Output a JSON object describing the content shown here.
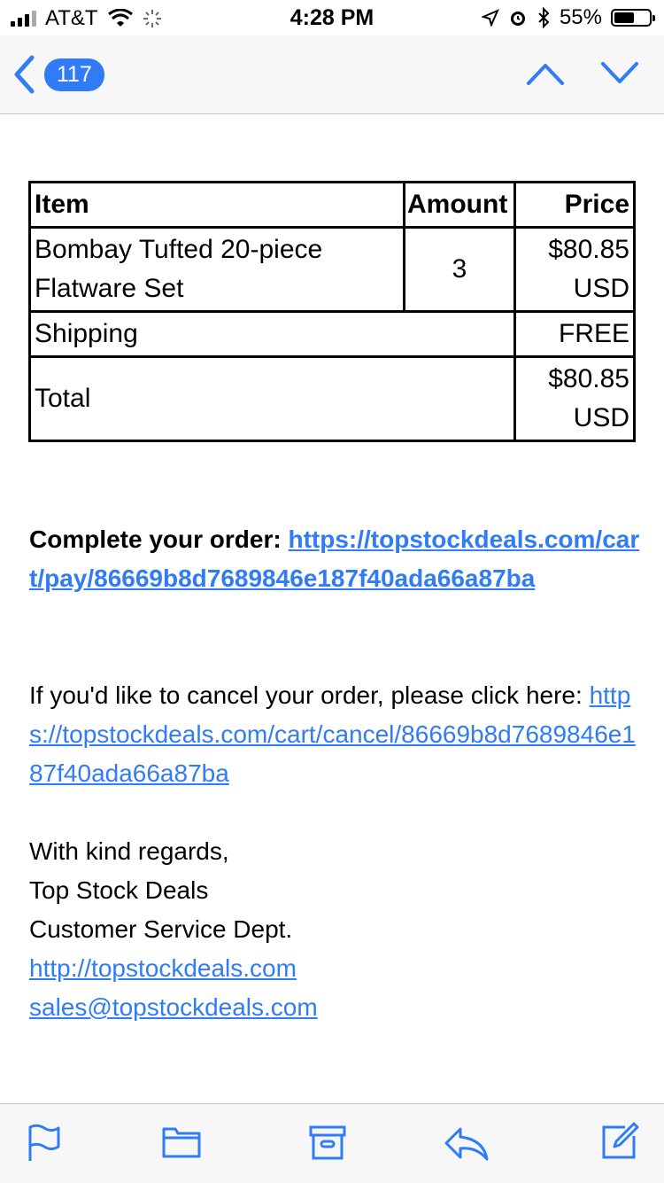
{
  "status_bar": {
    "carrier": "AT&T",
    "time": "4:28 PM",
    "battery_pct": "55%"
  },
  "nav": {
    "unread_count": "117"
  },
  "order_table": {
    "headers": {
      "item": "Item",
      "amount": "Amount",
      "price": "Price"
    },
    "item_row": {
      "name": "Bombay Tufted 20-piece Flatware Set",
      "amount": "3",
      "price": "$80.85 USD"
    },
    "shipping_row": {
      "label": "Shipping",
      "value": "FREE"
    },
    "total_row": {
      "label": "Total",
      "value": "$80.85 USD"
    }
  },
  "body": {
    "complete_label": "Complete your order:",
    "complete_link": "https://topstockdeals.com/cart/pay/86669b8d7689846e187f40ada66a87ba",
    "cancel_text": "If you'd like to cancel your order, please click here:",
    "cancel_link": "https://topstockdeals.com/cart/cancel/86669b8d7689846e187f40ada66a87ba",
    "signoff": "With kind regards,",
    "company": "Top Stock Deals",
    "dept": "Customer Service Dept.",
    "website_link": "http://topstockdeals.com",
    "email_link": "sales@topstockdeals.com"
  },
  "colors": {
    "accent": "#2f7cf6",
    "toolbar_bg": "#f7f7f7"
  },
  "icons": [
    "chevron-left-icon",
    "chevron-up-icon",
    "chevron-down-icon",
    "flag-icon",
    "folder-icon",
    "archive-icon",
    "reply-icon",
    "compose-icon",
    "wifi-icon",
    "location-icon",
    "alarm-icon",
    "bluetooth-icon"
  ]
}
